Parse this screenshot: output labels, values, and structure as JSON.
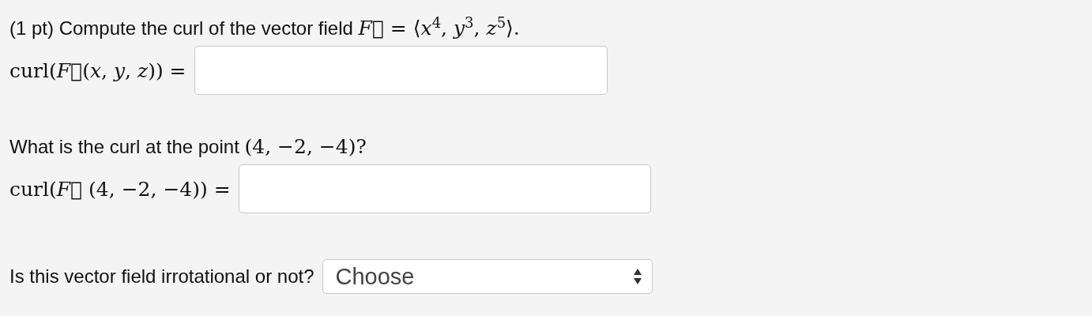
{
  "problem": {
    "intro": {
      "text": "(1 pt) Compute the curl of the vector field",
      "math": "*F⃗* =  ⟨*x*$^{4}$, *y*$^{3}$, *z*$^{5}$⟩."
    },
    "answers": [
      {
        "label": "curl(*F⃗*(*x*, *y*, *z*)) ="
      },
      {
        "question": {
          "text": "What is the curl at the point",
          "math": "(4, −2, −4)?"
        },
        "label": "curl(*F⃗* (4, −2, −4)) ="
      }
    ],
    "select": {
      "question": "Is this vector field irrotational or not?",
      "value": "Choose"
    }
  }
}
